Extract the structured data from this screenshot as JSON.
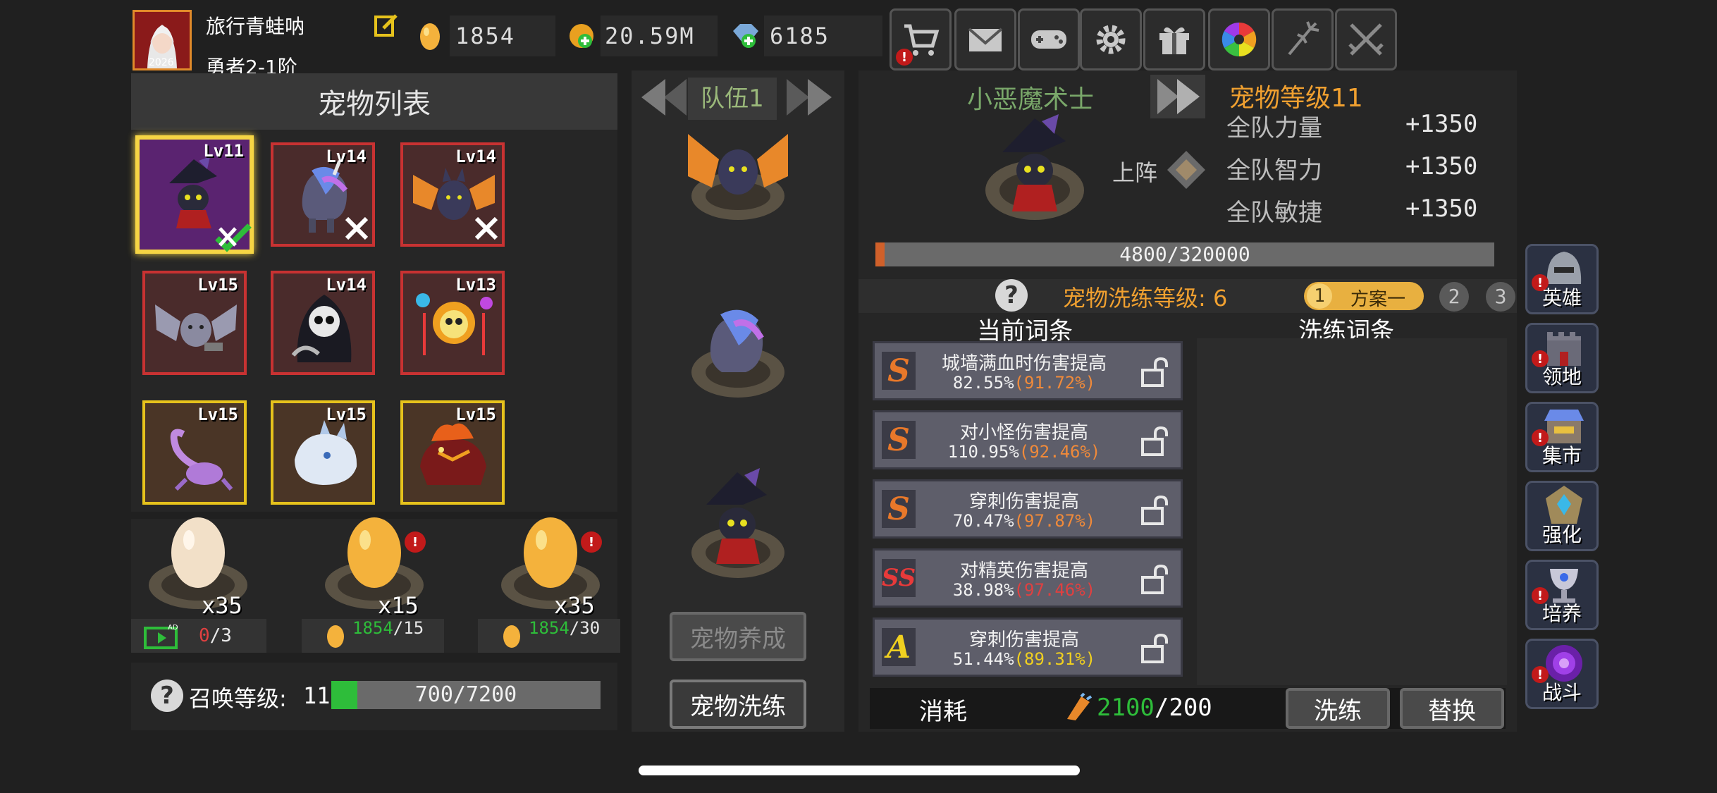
{
  "player": {
    "name": "旅行青蛙呐",
    "rank": "勇者2-1阶",
    "avatar_year": "2026"
  },
  "resources": {
    "eggs": "1854",
    "gold": "20.59M",
    "gems": "6185"
  },
  "toolbar": [
    "cart-icon",
    "mail-icon",
    "gamepad-icon",
    "gear-icon",
    "gift-icon",
    "color-wheel-icon",
    "fireworks-icon",
    "crossed-swords-icon"
  ],
  "pet_list": {
    "title": "宠物列表",
    "pets": [
      {
        "lvl": "Lv11",
        "name": "witch-imp"
      },
      {
        "lvl": "Lv14",
        "name": "galaxy-unicorn"
      },
      {
        "lvl": "Lv14",
        "name": "fire-bat"
      },
      {
        "lvl": "Lv15",
        "name": "grey-bat"
      },
      {
        "lvl": "Lv14",
        "name": "reaper"
      },
      {
        "lvl": "Lv13",
        "name": "flame-skull"
      },
      {
        "lvl": "Lv15",
        "name": "purple-scorpion"
      },
      {
        "lvl": "Lv15",
        "name": "ice-wolf"
      },
      {
        "lvl": "Lv15",
        "name": "lava-beast"
      }
    ]
  },
  "eggs": [
    {
      "count": "x35",
      "cost_used": "0",
      "cost_total": "/3"
    },
    {
      "count": "x15",
      "cost_used": "1854",
      "cost_total": "/15"
    },
    {
      "count": "x35",
      "cost_used": "1854",
      "cost_total": "/30"
    }
  ],
  "summon": {
    "label": "召唤等级:",
    "level": "11",
    "progress": "700/7200",
    "fraction": 0.097
  },
  "team": {
    "title": "队伍1",
    "btn_raise": "宠物养成",
    "btn_refine": "宠物洗练"
  },
  "pet_detail": {
    "name": "小恶魔术士",
    "level_label": "宠物等级11",
    "deploy": "上阵",
    "stats": [
      {
        "label": "全队力量",
        "value": "+1350"
      },
      {
        "label": "全队智力",
        "value": "+1350"
      },
      {
        "label": "全队敏捷",
        "value": "+1350"
      }
    ],
    "exp": "4800/320000",
    "exp_fraction": 0.015
  },
  "refine": {
    "level_label": "宠物洗练等级: 6",
    "plans": [
      "1",
      "方案一",
      "2",
      "3"
    ],
    "current_title": "当前词条",
    "refine_title": "洗练词条",
    "entries": [
      {
        "grade": "S",
        "name": "城墙满血时伤害提高",
        "value": "82.55%",
        "pct": "(91.72%)"
      },
      {
        "grade": "S",
        "name": "对小怪伤害提高",
        "value": "110.95%",
        "pct": "(92.46%)"
      },
      {
        "grade": "S",
        "name": "穿刺伤害提高",
        "value": "70.47%",
        "pct": "(97.87%)"
      },
      {
        "grade": "SS",
        "name": "对精英伤害提高",
        "value": "38.98%",
        "pct": "(97.46%)"
      },
      {
        "grade": "A",
        "name": "穿刺伤害提高",
        "value": "51.44%",
        "pct": "(89.31%)"
      }
    ],
    "cost_label": "消耗",
    "cost_have": "2100",
    "cost_need": "/200",
    "btn_refine": "洗练",
    "btn_replace": "替换"
  },
  "side_menu": [
    "英雄",
    "领地",
    "集市",
    "强化",
    "培养",
    "战斗"
  ],
  "colors": {
    "gold": "#f0a030",
    "green": "#2ebd3a",
    "pct_orange": "#f08a3a",
    "pct_red": "#e04040",
    "pct_yellow": "#f0d020"
  }
}
